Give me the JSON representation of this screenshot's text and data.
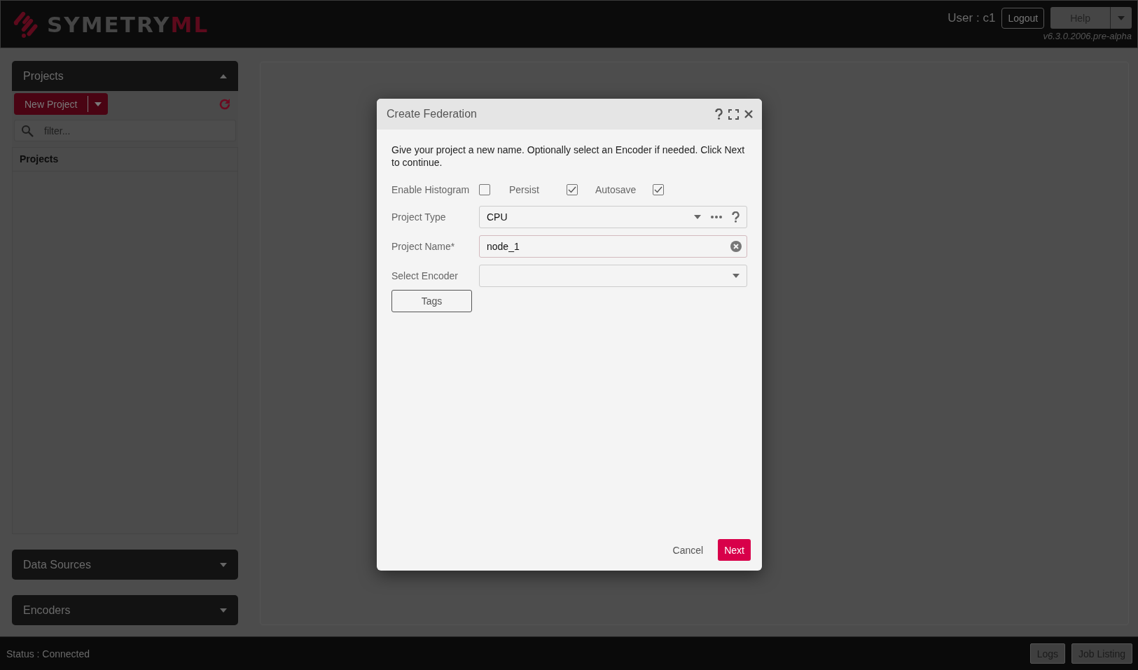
{
  "header": {
    "logo": {
      "text": "SYMETRY",
      "accent": "ML"
    },
    "user": "User : c1",
    "logout": "Logout",
    "help": "Help",
    "version": "v6.3.0.2006.pre-alpha"
  },
  "sidebar": {
    "panels": [
      {
        "title": "Projects",
        "expanded": true,
        "new_button": "New Project",
        "filter_placeholder": "filter...",
        "list_header": "Projects"
      },
      {
        "title": "Data Sources",
        "expanded": false
      },
      {
        "title": "Encoders",
        "expanded": false
      }
    ]
  },
  "dialog": {
    "title": "Create Federation",
    "intro": "Give your project a new name. Optionally select an Encoder if needed. Click Next to continue.",
    "options": [
      {
        "label": "Enable Histogram",
        "checked": false
      },
      {
        "label": "Persist",
        "checked": true
      },
      {
        "label": "Autosave",
        "checked": true
      }
    ],
    "fields": [
      {
        "kind": "picker",
        "label": "Project Type",
        "value": "CPU"
      },
      {
        "kind": "text",
        "label": "Project Name*",
        "value": "node_1"
      },
      {
        "kind": "select",
        "label": "Select Encoder"
      }
    ],
    "tags_button": "Tags",
    "buttons": [
      {
        "kind": "flat",
        "label": "Cancel"
      },
      {
        "kind": "primary",
        "label": "Next"
      }
    ]
  },
  "status_bar": {
    "status": "Status : Connected",
    "buttons": [
      "Logs",
      "Job Listing"
    ]
  }
}
